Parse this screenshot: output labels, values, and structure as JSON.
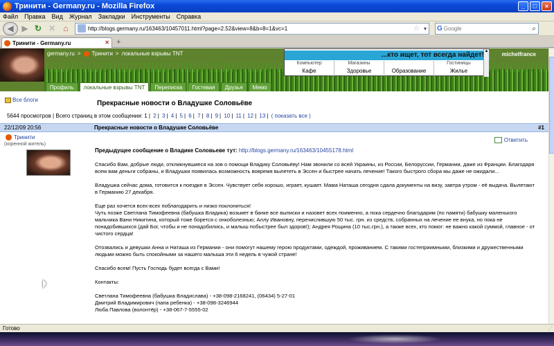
{
  "window": {
    "title": "Тринити - Germany.ru - Mozilla Firefox",
    "controls": [
      "_",
      "□",
      "×"
    ]
  },
  "menubar": [
    "Файл",
    "Правка",
    "Вид",
    "Журнал",
    "Закладки",
    "Инструменты",
    "Справка"
  ],
  "navigation": {
    "url": "http://blogs.germany.ru/163463/10457011.html?page=2.52&view=8&b=8=1&vc=1",
    "search_placeholder": "Google"
  },
  "tab": {
    "label": "Тринити - Germany.ru",
    "new_tab_glyph": "+"
  },
  "site": {
    "breadcrumb": [
      "germany.ru",
      ">",
      "Тринити",
      ">",
      "локальные взрывы TNT"
    ],
    "slogan": "...кто ищет, тот всегда найдет!",
    "categories": [
      {
        "sub": "Компьютер",
        "label": "Кафе"
      },
      {
        "sub": "Магазины",
        "label": "Здоровье"
      },
      {
        "sub": "",
        "label": "Образование"
      },
      {
        "sub": "Гостиницы",
        "label": "Жилье"
      }
    ],
    "username": "michelfrance",
    "tabs": [
      "Профиль",
      "локальные взрывы TNT",
      "Переписка",
      "Гостевая",
      "Друзья",
      "Мемо"
    ],
    "active_tab_index": 1
  },
  "sidebar": {
    "all_blogs": "Все блоги"
  },
  "post": {
    "heading": "Прекрасные новости о Владушке Соловьёве",
    "views_text": "5644 просмотров | Всего страниц в этом сообщении: 1 |",
    "pages": [
      "2",
      "3",
      "4",
      "5",
      "6",
      "7",
      "8",
      "9",
      "10",
      "11",
      "12",
      "13"
    ],
    "show_all": "( показать все )",
    "date": "22/12/09 20:56",
    "title": "Прекрасные новости о Владушке Соловьёве",
    "number": "#1",
    "author": "Тринити",
    "author_role": "(коренной житель)",
    "reply": "Ответить",
    "prev_label": "Предыдущее сообщение о Владике Соловьеве тут:",
    "prev_link": "http://blogs.germany.ru/163463/10455178.html",
    "paragraphs": [
      "Спасибо Вам, добрые люди, откликнувшиеся на зов о помощи Владику Соловьёву! Нам звонили со всей Украины, из России, Белоруссии, Германии, даже из Франции. Благодаря всем вам деньги собраны, и Владушки появилась возможность вовремя вылететь в Эссен и быстрее начать лечение! Такого быстрого сбора мы даже не ожидали...",
      "Владушка сейчас дома, готовится к поездке в Эссен. Чувствует себя хорошо, играет, кушает. Мама Наташа сегодня сдала документы на визу, завтра утром - её выдача. Вылетают в Германию 27 декабря.",
      "Еще раз хочется всех-всех поблагодарить и низко поклониться!\nЧуть позже Светлана Тимофеевна (бабушка Владика) возьмет в банке все выписки и назовет всех поименно, а пока сердечно благодарим (по памяти) бабушку маленького мальчика Вани Никитина, который тоже борется с онкоболезнью; Аллу Ивановну, перечислившую 50 тыс. грн. из средств, собранных на лечение ее внука, но пока не понадобившихся (дай Бог, чтобы и не понадобились, и малыш побыстрее был здоров!); Андрея Рощина (10 тыс.грн.), а также всех, кто помог: не важно какой суммой, главное - от чистого сердца!",
      "Отозвались и девушки Анна и Наташа из Германии - они помогут нашему герою продуктами, одеждой, проживанием. С такими гостеприимными, близкими и дружественными людьми можно быть спокойными за нашего малыша эти 6 недель в чужой стране!",
      "Спасибо всем! Пусть Господь будет всегда с Вами!",
      "Контакты:",
      "Светлана Тимофеевна (бабушка Владислава) - +38-098-2168241, (06434) 5-27-01\nДмитрий Владимирович (папа ребенка) - +38-098-3246944\nЛюба Павлова (волонтёр) - +38-067-7-5555-02"
    ]
  },
  "status": {
    "text": "Готово"
  }
}
